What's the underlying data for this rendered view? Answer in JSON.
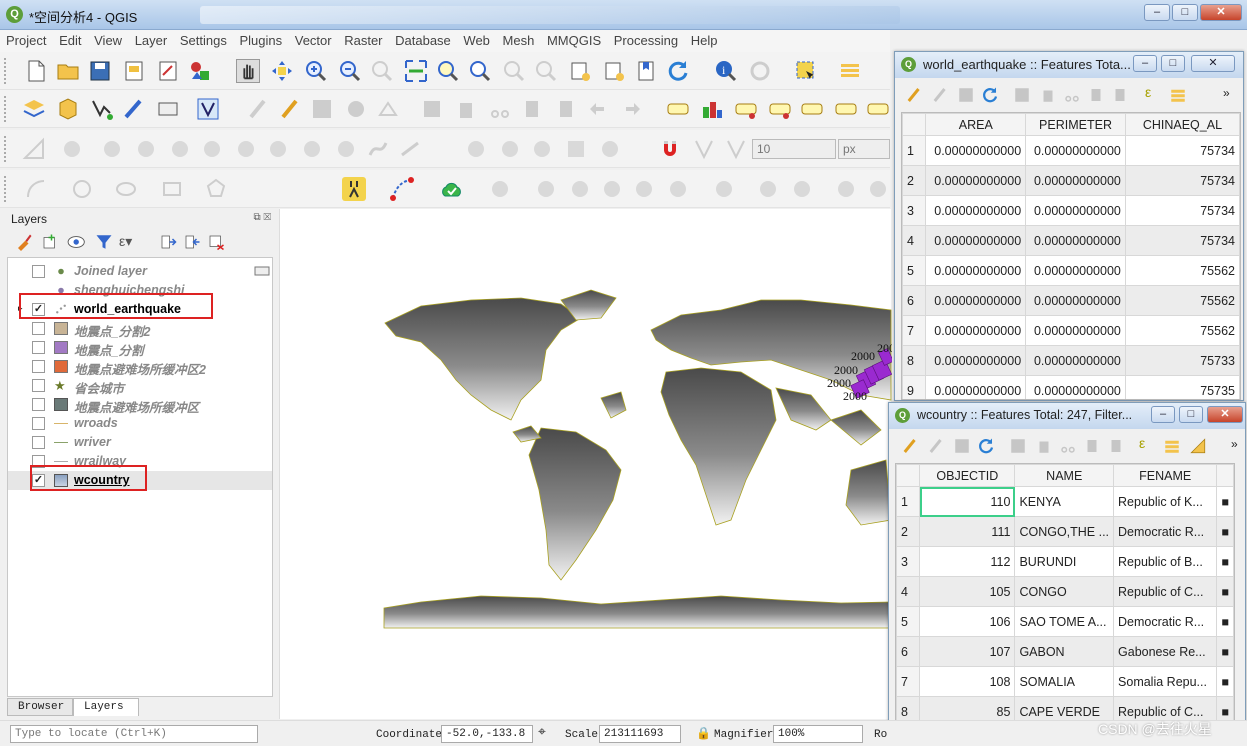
{
  "window": {
    "title": "*空间分析4 - QGIS",
    "logo": "Q"
  },
  "menu": [
    "Project",
    "Edit",
    "View",
    "Layer",
    "Settings",
    "Plugins",
    "Vector",
    "Raster",
    "Database",
    "Web",
    "Mesh",
    "MMQGIS",
    "Processing",
    "Help"
  ],
  "layers_panel": {
    "title": "Layers",
    "items": [
      {
        "label": "Joined layer",
        "checked": false
      },
      {
        "label": "shenghuichengshi",
        "checked": false
      },
      {
        "label": "world_earthquake",
        "checked": true,
        "check": "✓"
      },
      {
        "label": "地震点_分割2",
        "checked": false
      },
      {
        "label": "地震点_分割",
        "checked": false
      },
      {
        "label": "地震点避难场所缓冲区2",
        "checked": false
      },
      {
        "label": "省会城市",
        "checked": false
      },
      {
        "label": "地震点避难场所缓冲区",
        "checked": false
      },
      {
        "label": "wroads",
        "checked": false
      },
      {
        "label": "wriver",
        "checked": false
      },
      {
        "label": "wrailway",
        "checked": false
      },
      {
        "label": "wcountry",
        "checked": true,
        "check": "✓"
      }
    ],
    "tabs": [
      "Browser",
      "Layers"
    ]
  },
  "toolbar": {
    "size_value": "10",
    "unit_value": "px"
  },
  "map": {
    "label_text": "2000"
  },
  "status": {
    "locate_placeholder": "Type to locate (Ctrl+K)",
    "coordinate_label": "Coordinate",
    "coordinate_value": "-52.0,-133.8",
    "scale_label": "Scale",
    "scale_value": "213111693",
    "magnifier_label": "Magnifier",
    "magnifier_value": "100%",
    "rotation_label": "Ro"
  },
  "earthquake_table": {
    "title": "world_earthquake :: Features Tota...",
    "columns": [
      "AREA",
      "PERIMETER",
      "CHINAEQ_AL"
    ],
    "rows": [
      {
        "n": "1",
        "area": "0.00000000000",
        "perimeter": "0.00000000000",
        "chinaeq": "75734"
      },
      {
        "n": "2",
        "area": "0.00000000000",
        "perimeter": "0.00000000000",
        "chinaeq": "75734"
      },
      {
        "n": "3",
        "area": "0.00000000000",
        "perimeter": "0.00000000000",
        "chinaeq": "75734"
      },
      {
        "n": "4",
        "area": "0.00000000000",
        "perimeter": "0.00000000000",
        "chinaeq": "75734"
      },
      {
        "n": "5",
        "area": "0.00000000000",
        "perimeter": "0.00000000000",
        "chinaeq": "75562"
      },
      {
        "n": "6",
        "area": "0.00000000000",
        "perimeter": "0.00000000000",
        "chinaeq": "75562"
      },
      {
        "n": "7",
        "area": "0.00000000000",
        "perimeter": "0.00000000000",
        "chinaeq": "75562"
      },
      {
        "n": "8",
        "area": "0.00000000000",
        "perimeter": "0.00000000000",
        "chinaeq": "75733"
      },
      {
        "n": "9",
        "area": "0.00000000000",
        "perimeter": "0.00000000000",
        "chinaeq": "75735"
      }
    ]
  },
  "country_table": {
    "title": "wcountry :: Features Total: 247, Filter...",
    "columns": [
      "OBJECTID",
      "NAME",
      "FENAME"
    ],
    "rows": [
      {
        "n": "1",
        "id": "110",
        "name": "KENYA",
        "fename": "Republic of K...",
        "extra": "■"
      },
      {
        "n": "2",
        "id": "111",
        "name": "CONGO,THE ...",
        "fename": "Democratic R...",
        "extra": "■"
      },
      {
        "n": "3",
        "id": "112",
        "name": "BURUNDI",
        "fename": "Republic of B...",
        "extra": "■"
      },
      {
        "n": "4",
        "id": "105",
        "name": "CONGO",
        "fename": "Republic of C...",
        "extra": "■"
      },
      {
        "n": "5",
        "id": "106",
        "name": "SAO TOME A...",
        "fename": "Democratic R...",
        "extra": "■"
      },
      {
        "n": "6",
        "id": "107",
        "name": "GABON",
        "fename": "Gabonese Re...",
        "extra": "■"
      },
      {
        "n": "7",
        "id": "108",
        "name": "SOMALIA",
        "fename": "Somalia Repu...",
        "extra": "■"
      },
      {
        "n": "8",
        "id": "85",
        "name": "CAPE VERDE",
        "fename": "Republic of C...",
        "extra": "■"
      }
    ]
  },
  "watermark": "CSDN @去往火星"
}
